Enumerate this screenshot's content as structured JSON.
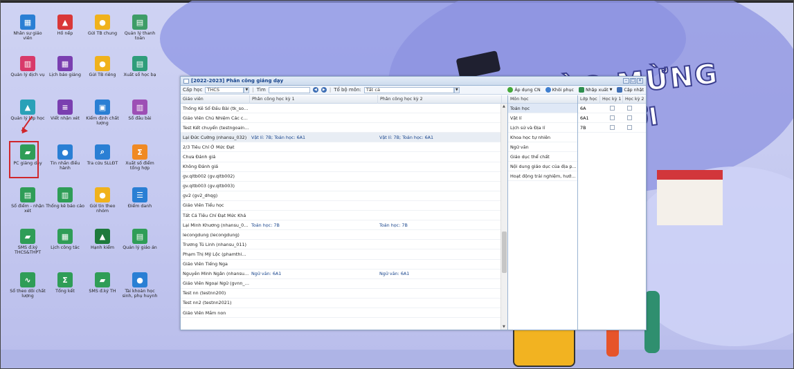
{
  "desktop_icons": [
    {
      "label": "Nhân sự giáo viên",
      "icon": "staff-icon",
      "color": "#2a7fd4",
      "glyph": "▦"
    },
    {
      "label": "Hồ nếp",
      "icon": "warning-icon",
      "color": "#d93838",
      "glyph": "▲"
    },
    {
      "label": "Gửi TB chung",
      "icon": "bell-icon",
      "color": "#f0b21c",
      "glyph": "●"
    },
    {
      "label": "Quản lý thanh toán",
      "icon": "payment-icon",
      "color": "#3e9d67",
      "glyph": "▤"
    },
    {
      "label": "Quản lý dịch vụ",
      "icon": "service-icon",
      "color": "#d83a6a",
      "glyph": "▥"
    },
    {
      "label": "Lịch báo giảng",
      "icon": "calendar-icon",
      "color": "#7a3fb0",
      "glyph": "▦"
    },
    {
      "label": "Gửi TB riêng",
      "icon": "bell-icon",
      "color": "#f0b21c",
      "glyph": "●"
    },
    {
      "label": "Xuất sổ học bạ",
      "icon": "export-icon",
      "color": "#2f9d7b",
      "glyph": "▤"
    },
    {
      "label": "Quản lý lớp học",
      "icon": "class-icon",
      "color": "#2aa1b8",
      "glyph": "▲"
    },
    {
      "label": "Viết nhận xét",
      "icon": "comment-icon",
      "color": "#7a3fb0",
      "glyph": "≡"
    },
    {
      "label": "Kiểm định chất lượng",
      "icon": "quality-icon",
      "color": "#2a7fd4",
      "glyph": "▣"
    },
    {
      "label": "Sổ đầu bài",
      "icon": "book-icon",
      "color": "#9d4fb5",
      "glyph": "▥"
    },
    {
      "label": "PC giảng dạy",
      "icon": "assign-teaching-icon",
      "color": "#2f9d57",
      "glyph": "▰"
    },
    {
      "label": "Tin nhắn điều hành",
      "icon": "message-icon",
      "color": "#2a7fd4",
      "glyph": "●"
    },
    {
      "label": "Tra cứu SLLĐT",
      "icon": "search-icon",
      "color": "#2a7fd4",
      "glyph": "⌕"
    },
    {
      "label": "Xuất số điểm tổng hợp",
      "icon": "sum-icon",
      "color": "#f08a24",
      "glyph": "Σ"
    },
    {
      "label": "Sổ điểm - nhận xét",
      "icon": "grade-icon",
      "color": "#2f9d57",
      "glyph": "▤"
    },
    {
      "label": "Thống kê báo cáo",
      "icon": "stats-icon",
      "color": "#2f9d57",
      "glyph": "▥"
    },
    {
      "label": "Gửi tin theo nhóm",
      "icon": "group-bell-icon",
      "color": "#f0b21c",
      "glyph": "●"
    },
    {
      "label": "Điểm danh",
      "icon": "attendance-icon",
      "color": "#2a7fd4",
      "glyph": "☰"
    },
    {
      "label": "SMS đ.ký THCS&THPT",
      "icon": "sms-icon",
      "color": "#2f9d57",
      "glyph": "▰"
    },
    {
      "label": "Lịch công tác",
      "icon": "schedule-icon",
      "color": "#2f9d57",
      "glyph": "▦"
    },
    {
      "label": "Hạnh kiểm",
      "icon": "conduct-icon",
      "color": "#1e7a3c",
      "glyph": "▲"
    },
    {
      "label": "Quản lý giáo án",
      "icon": "lesson-plan-icon",
      "color": "#2f9d57",
      "glyph": "▤"
    },
    {
      "label": "Sổ theo dõi chất lượng",
      "icon": "chart-icon",
      "color": "#2f9d57",
      "glyph": "∿"
    },
    {
      "label": "Tổng kết",
      "icon": "summary-icon",
      "color": "#2f9d57",
      "glyph": "Σ"
    },
    {
      "label": "SMS đ.ký TH",
      "icon": "sms-icon",
      "color": "#2f9d57",
      "glyph": "▰"
    },
    {
      "label": "Tài khoản học sinh, phụ huynh",
      "icon": "account-icon",
      "color": "#2a7fd4",
      "glyph": "●"
    }
  ],
  "window": {
    "title": "[2022-2023] Phân công giảng dạy",
    "toolbar": {
      "level_label": "Cấp học",
      "level_value": "THCS",
      "search_label": "Tìm",
      "search_value": "",
      "dept_label": "Tổ bộ môn:",
      "dept_value": "Tất cả",
      "apply_label": "Áp dụng CN",
      "restore_label": "Khôi phục",
      "import_label": "Nhập xuất",
      "update_label": "Cập nhật"
    },
    "columns": [
      "Giáo viên",
      "Phân công học kỳ 1",
      "Phân công học kỳ 2"
    ],
    "rows": [
      {
        "teacher": "Thống Kê Sổ Đầu Bài (tk_sodau...",
        "hk1": "",
        "hk2": ""
      },
      {
        "teacher": "Giáo Viên Chủ Nhiệm Các cấp (g...",
        "hk1": "",
        "hk2": ""
      },
      {
        "teacher": "Test Kết chuyển (testngoaingu)",
        "hk1": "",
        "hk2": ""
      },
      {
        "teacher": "Lại Đức Cường (nhansu_032)",
        "hk1": "Vật lí: 7B; Toán học: 6A1",
        "hk2": "Vật lí: 7B; Toán học: 6A1"
      },
      {
        "teacher": "2/3 Tiêu Chí Ở Mức Đạt",
        "hk1": "",
        "hk2": ""
      },
      {
        "teacher": "Chưa Đánh giá",
        "hk1": "",
        "hk2": ""
      },
      {
        "teacher": "Không Đánh giá",
        "hk1": "",
        "hk2": ""
      },
      {
        "teacher": "gv.qltb002 (gv.qltb002)",
        "hk1": "",
        "hk2": ""
      },
      {
        "teacher": "gv.qltb003 (gv.qltb003)",
        "hk1": "",
        "hk2": ""
      },
      {
        "teacher": "gv2 (gv2_dhqg)",
        "hk1": "",
        "hk2": ""
      },
      {
        "teacher": "Giáo Viên Tiểu học",
        "hk1": "",
        "hk2": ""
      },
      {
        "teacher": "Tất Cả Tiêu Chí Đạt Mức Khá",
        "hk1": "",
        "hk2": ""
      },
      {
        "teacher": "Lại Minh Khương (nhansu_030)",
        "hk1": "Toán học: 7B",
        "hk2": "Toán học: 7B"
      },
      {
        "teacher": "lecongdung (lecongdung)",
        "hk1": "",
        "hk2": ""
      },
      {
        "teacher": "Trương Tú Linh (nhansu_011)",
        "hk1": "",
        "hk2": ""
      },
      {
        "teacher": "Phạm Thị Mỹ Lộc (phamthimyloc...",
        "hk1": "",
        "hk2": ""
      },
      {
        "teacher": "Giáo Viên Tiếng Nga",
        "hk1": "",
        "hk2": ""
      },
      {
        "teacher": "Nguyễn Minh Ngân (nhansu_001)",
        "hk1": "Ngữ văn: 6A1",
        "hk2": "Ngữ văn: 6A1"
      },
      {
        "teacher": "Giáo Viên Ngoại Ngữ (gvnn_2020)",
        "hk1": "",
        "hk2": ""
      },
      {
        "teacher": "Test nn (testnn200)",
        "hk1": "",
        "hk2": ""
      },
      {
        "teacher": "Test nn2 (testnn2021)",
        "hk1": "",
        "hk2": ""
      },
      {
        "teacher": "Giáo Viên Mầm non",
        "hk1": "",
        "hk2": ""
      }
    ],
    "subjects_header": "Môn học",
    "subjects": [
      "Toán học",
      "Vật lí",
      "Lịch sử và Địa lí",
      "Khoa học tự nhiên",
      "Ngữ văn",
      "Giáo dục thể chất",
      "Nội dung giáo dục của địa p...",
      "Hoạt động trải nghiệm, hướ..."
    ],
    "class_columns": [
      "Lớp học",
      "Học kỳ 1",
      "Học kỳ 2"
    ],
    "classes": [
      "6A",
      "6A1",
      "7B"
    ]
  },
  "wallpaper": {
    "banner_line1": "ÀO MỪNG",
    "banner_line2": "ỚI"
  }
}
